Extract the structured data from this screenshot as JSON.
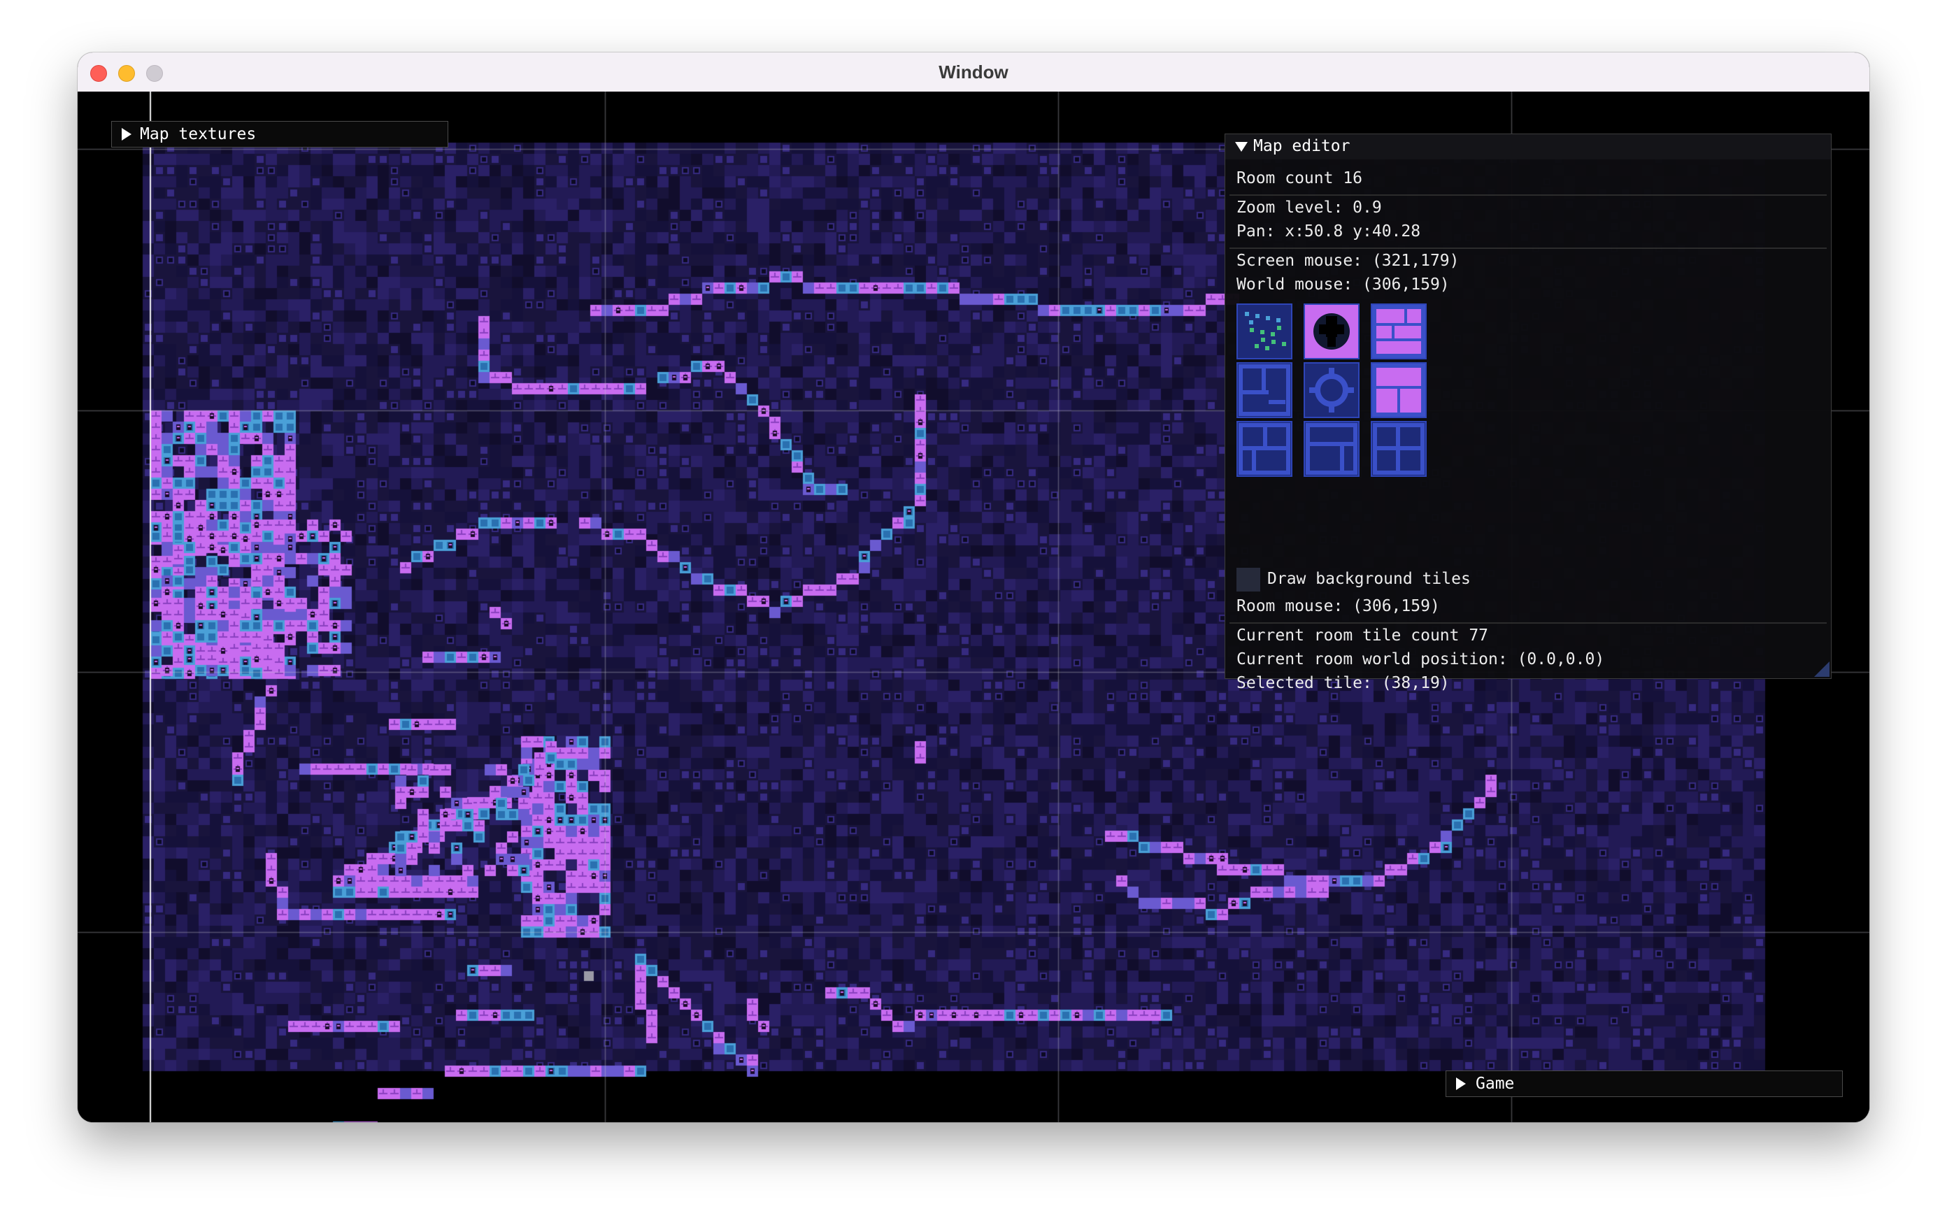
{
  "window": {
    "title": "Window"
  },
  "panels": {
    "map_textures": {
      "label": "Map textures",
      "state": "collapsed"
    },
    "game": {
      "label": "Game",
      "state": "collapsed"
    },
    "map_editor": {
      "label": "Map editor",
      "state": "expanded",
      "room_count": "Room count 16",
      "zoom_level": "Zoom level: 0.9",
      "pan": "Pan: x:50.8 y:40.28",
      "screen_mouse": "Screen mouse: (321,179)",
      "world_mouse": "World mouse: (306,159)",
      "tiles": [
        {
          "name": "scatter-tile-icon"
        },
        {
          "name": "skull-tile-icon"
        },
        {
          "name": "pink-brick-tile-icon"
        },
        {
          "name": "blue-wall-tile-icon"
        },
        {
          "name": "gear-tile-icon"
        },
        {
          "name": "pink-block-tile-icon"
        },
        {
          "name": "brick-wall-tile-icon"
        },
        {
          "name": "brick-corner-tile-icon"
        },
        {
          "name": "brick-cross-tile-icon"
        }
      ],
      "draw_background_label": "Draw background tiles",
      "draw_background_checked": false,
      "room_mouse": "Room mouse: (306,159)",
      "current_room_tile_count": "Current room tile count 77",
      "current_room_world_position": "Current room world position: (0.0,0.0)",
      "selected_tile": "Selected tile: (38,19)"
    }
  },
  "colors": {
    "background": "#000000",
    "room_fill": "#1a1442",
    "tile_purple": "#c86cf0",
    "tile_cyan": "#4aa0d8",
    "tile_blue": "#4040a0",
    "panel_bg": "#0c0c0e",
    "grid_line": "#5a5a5a"
  }
}
